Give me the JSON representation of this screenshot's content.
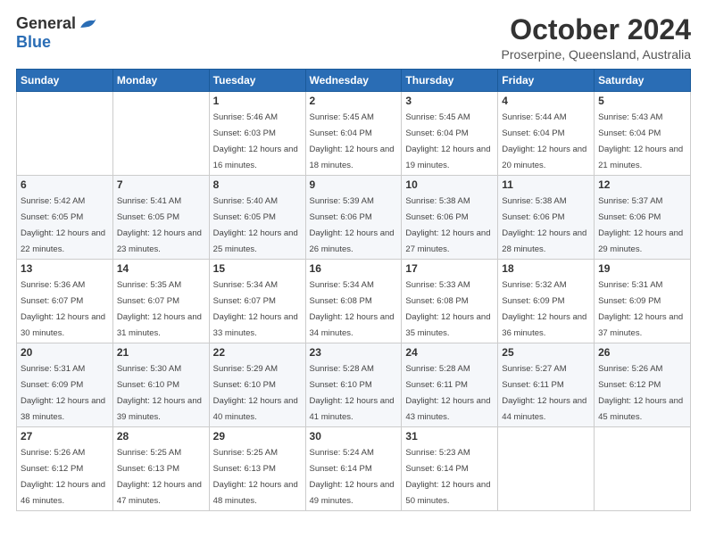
{
  "logo": {
    "general": "General",
    "blue": "Blue"
  },
  "header": {
    "title": "October 2024",
    "subtitle": "Proserpine, Queensland, Australia"
  },
  "weekdays": [
    "Sunday",
    "Monday",
    "Tuesday",
    "Wednesday",
    "Thursday",
    "Friday",
    "Saturday"
  ],
  "weeks": [
    [
      {
        "day": "",
        "sunrise": "",
        "sunset": "",
        "daylight": ""
      },
      {
        "day": "",
        "sunrise": "",
        "sunset": "",
        "daylight": ""
      },
      {
        "day": "1",
        "sunrise": "Sunrise: 5:46 AM",
        "sunset": "Sunset: 6:03 PM",
        "daylight": "Daylight: 12 hours and 16 minutes."
      },
      {
        "day": "2",
        "sunrise": "Sunrise: 5:45 AM",
        "sunset": "Sunset: 6:04 PM",
        "daylight": "Daylight: 12 hours and 18 minutes."
      },
      {
        "day": "3",
        "sunrise": "Sunrise: 5:45 AM",
        "sunset": "Sunset: 6:04 PM",
        "daylight": "Daylight: 12 hours and 19 minutes."
      },
      {
        "day": "4",
        "sunrise": "Sunrise: 5:44 AM",
        "sunset": "Sunset: 6:04 PM",
        "daylight": "Daylight: 12 hours and 20 minutes."
      },
      {
        "day": "5",
        "sunrise": "Sunrise: 5:43 AM",
        "sunset": "Sunset: 6:04 PM",
        "daylight": "Daylight: 12 hours and 21 minutes."
      }
    ],
    [
      {
        "day": "6",
        "sunrise": "Sunrise: 5:42 AM",
        "sunset": "Sunset: 6:05 PM",
        "daylight": "Daylight: 12 hours and 22 minutes."
      },
      {
        "day": "7",
        "sunrise": "Sunrise: 5:41 AM",
        "sunset": "Sunset: 6:05 PM",
        "daylight": "Daylight: 12 hours and 23 minutes."
      },
      {
        "day": "8",
        "sunrise": "Sunrise: 5:40 AM",
        "sunset": "Sunset: 6:05 PM",
        "daylight": "Daylight: 12 hours and 25 minutes."
      },
      {
        "day": "9",
        "sunrise": "Sunrise: 5:39 AM",
        "sunset": "Sunset: 6:06 PM",
        "daylight": "Daylight: 12 hours and 26 minutes."
      },
      {
        "day": "10",
        "sunrise": "Sunrise: 5:38 AM",
        "sunset": "Sunset: 6:06 PM",
        "daylight": "Daylight: 12 hours and 27 minutes."
      },
      {
        "day": "11",
        "sunrise": "Sunrise: 5:38 AM",
        "sunset": "Sunset: 6:06 PM",
        "daylight": "Daylight: 12 hours and 28 minutes."
      },
      {
        "day": "12",
        "sunrise": "Sunrise: 5:37 AM",
        "sunset": "Sunset: 6:06 PM",
        "daylight": "Daylight: 12 hours and 29 minutes."
      }
    ],
    [
      {
        "day": "13",
        "sunrise": "Sunrise: 5:36 AM",
        "sunset": "Sunset: 6:07 PM",
        "daylight": "Daylight: 12 hours and 30 minutes."
      },
      {
        "day": "14",
        "sunrise": "Sunrise: 5:35 AM",
        "sunset": "Sunset: 6:07 PM",
        "daylight": "Daylight: 12 hours and 31 minutes."
      },
      {
        "day": "15",
        "sunrise": "Sunrise: 5:34 AM",
        "sunset": "Sunset: 6:07 PM",
        "daylight": "Daylight: 12 hours and 33 minutes."
      },
      {
        "day": "16",
        "sunrise": "Sunrise: 5:34 AM",
        "sunset": "Sunset: 6:08 PM",
        "daylight": "Daylight: 12 hours and 34 minutes."
      },
      {
        "day": "17",
        "sunrise": "Sunrise: 5:33 AM",
        "sunset": "Sunset: 6:08 PM",
        "daylight": "Daylight: 12 hours and 35 minutes."
      },
      {
        "day": "18",
        "sunrise": "Sunrise: 5:32 AM",
        "sunset": "Sunset: 6:09 PM",
        "daylight": "Daylight: 12 hours and 36 minutes."
      },
      {
        "day": "19",
        "sunrise": "Sunrise: 5:31 AM",
        "sunset": "Sunset: 6:09 PM",
        "daylight": "Daylight: 12 hours and 37 minutes."
      }
    ],
    [
      {
        "day": "20",
        "sunrise": "Sunrise: 5:31 AM",
        "sunset": "Sunset: 6:09 PM",
        "daylight": "Daylight: 12 hours and 38 minutes."
      },
      {
        "day": "21",
        "sunrise": "Sunrise: 5:30 AM",
        "sunset": "Sunset: 6:10 PM",
        "daylight": "Daylight: 12 hours and 39 minutes."
      },
      {
        "day": "22",
        "sunrise": "Sunrise: 5:29 AM",
        "sunset": "Sunset: 6:10 PM",
        "daylight": "Daylight: 12 hours and 40 minutes."
      },
      {
        "day": "23",
        "sunrise": "Sunrise: 5:28 AM",
        "sunset": "Sunset: 6:10 PM",
        "daylight": "Daylight: 12 hours and 41 minutes."
      },
      {
        "day": "24",
        "sunrise": "Sunrise: 5:28 AM",
        "sunset": "Sunset: 6:11 PM",
        "daylight": "Daylight: 12 hours and 43 minutes."
      },
      {
        "day": "25",
        "sunrise": "Sunrise: 5:27 AM",
        "sunset": "Sunset: 6:11 PM",
        "daylight": "Daylight: 12 hours and 44 minutes."
      },
      {
        "day": "26",
        "sunrise": "Sunrise: 5:26 AM",
        "sunset": "Sunset: 6:12 PM",
        "daylight": "Daylight: 12 hours and 45 minutes."
      }
    ],
    [
      {
        "day": "27",
        "sunrise": "Sunrise: 5:26 AM",
        "sunset": "Sunset: 6:12 PM",
        "daylight": "Daylight: 12 hours and 46 minutes."
      },
      {
        "day": "28",
        "sunrise": "Sunrise: 5:25 AM",
        "sunset": "Sunset: 6:13 PM",
        "daylight": "Daylight: 12 hours and 47 minutes."
      },
      {
        "day": "29",
        "sunrise": "Sunrise: 5:25 AM",
        "sunset": "Sunset: 6:13 PM",
        "daylight": "Daylight: 12 hours and 48 minutes."
      },
      {
        "day": "30",
        "sunrise": "Sunrise: 5:24 AM",
        "sunset": "Sunset: 6:14 PM",
        "daylight": "Daylight: 12 hours and 49 minutes."
      },
      {
        "day": "31",
        "sunrise": "Sunrise: 5:23 AM",
        "sunset": "Sunset: 6:14 PM",
        "daylight": "Daylight: 12 hours and 50 minutes."
      },
      {
        "day": "",
        "sunrise": "",
        "sunset": "",
        "daylight": ""
      },
      {
        "day": "",
        "sunrise": "",
        "sunset": "",
        "daylight": ""
      }
    ]
  ]
}
